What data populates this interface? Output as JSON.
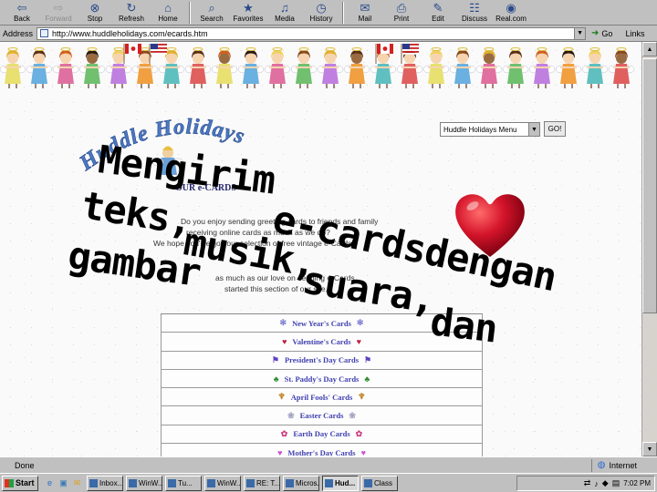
{
  "toolbar": {
    "buttons": [
      {
        "name": "back",
        "label": "Back",
        "icon": "arrow-left-icon",
        "glyph": "⇦",
        "enabled": true
      },
      {
        "name": "forward",
        "label": "Forward",
        "icon": "arrow-right-icon",
        "glyph": "⇨",
        "enabled": false
      },
      {
        "name": "stop",
        "label": "Stop",
        "icon": "stop-icon",
        "glyph": "⊗",
        "enabled": true
      },
      {
        "name": "refresh",
        "label": "Refresh",
        "icon": "refresh-icon",
        "glyph": "↻",
        "enabled": true
      },
      {
        "name": "home",
        "label": "Home",
        "icon": "home-icon",
        "glyph": "⌂",
        "enabled": true
      },
      {
        "name": "search",
        "label": "Search",
        "icon": "search-icon",
        "glyph": "⌕",
        "enabled": true
      },
      {
        "name": "favorites",
        "label": "Favorites",
        "icon": "star-icon",
        "glyph": "★",
        "enabled": true
      },
      {
        "name": "media",
        "label": "Media",
        "icon": "media-icon",
        "glyph": "♫",
        "enabled": true
      },
      {
        "name": "history",
        "label": "History",
        "icon": "history-icon",
        "glyph": "◷",
        "enabled": true
      },
      {
        "name": "mail",
        "label": "Mail",
        "icon": "mail-icon",
        "glyph": "✉",
        "enabled": true
      },
      {
        "name": "print",
        "label": "Print",
        "icon": "print-icon",
        "glyph": "⎙",
        "enabled": true
      },
      {
        "name": "edit",
        "label": "Edit",
        "icon": "edit-icon",
        "glyph": "✎",
        "enabled": true
      },
      {
        "name": "discuss",
        "label": "Discuss",
        "icon": "discuss-icon",
        "glyph": "☷",
        "enabled": true
      },
      {
        "name": "real",
        "label": "Real.com",
        "icon": "real-icon",
        "glyph": "◉",
        "enabled": true
      }
    ]
  },
  "address": {
    "label": "Address",
    "url": "http://www.huddleholidays.com/ecards.htm",
    "go_label": "Go",
    "links_label": "Links"
  },
  "page": {
    "logo_text": "Huddle Holidays",
    "section_title": "OUR e-CARDS",
    "menu_select": "Huddle Holidays Menu",
    "menu_go": "GO!",
    "intro_lines": [
      "Do you enjoy sending greeting cards to friends and family",
      "receiving online cards as much as we do?",
      "We hope you'll enjoy our selection of free vintage e-Cards",
      "as much as our love on sending e-Cards",
      "started this section of our site."
    ],
    "cards": [
      {
        "label": "New Year's Cards",
        "icon_name": "snowflake-icon",
        "glyph": "✻",
        "color": "#7a7ad0"
      },
      {
        "label": "Valentine's Cards",
        "icon_name": "heart-icon",
        "glyph": "♥",
        "color": "#c02040"
      },
      {
        "label": "President's Day Cards",
        "icon_name": "flag-icon",
        "glyph": "⚑",
        "color": "#6040c0"
      },
      {
        "label": "St. Paddy's Day Cards",
        "icon_name": "shamrock-icon",
        "glyph": "♣",
        "color": "#2a8a2a"
      },
      {
        "label": "April Fools' Cards",
        "icon_name": "jester-icon",
        "glyph": "♆",
        "color": "#c08020"
      },
      {
        "label": "Easter Cards",
        "icon_name": "bunny-icon",
        "glyph": "❀",
        "color": "#a0a0c0"
      },
      {
        "label": "Earth Day Cards",
        "icon_name": "earth-icon",
        "glyph": "✿",
        "color": "#d04080"
      },
      {
        "label": "Mother's Day Cards",
        "icon_name": "heart-icon",
        "glyph": "♥",
        "color": "#d050d0"
      }
    ]
  },
  "overlay": {
    "w1": "Mengirim",
    "w2": "e-cardsdengan",
    "w3": "teks,",
    "w4": "musik,",
    "w5": "suara,",
    "w6": "dan",
    "w7": "gambar"
  },
  "status": {
    "text": "Done",
    "zone": "Internet"
  },
  "taskbar": {
    "start_label": "Start",
    "tasks": [
      {
        "label": "Inbox...",
        "active": false
      },
      {
        "label": "WinW...",
        "active": false
      },
      {
        "label": "Tu...",
        "active": false
      },
      {
        "label": "WinW...",
        "active": false
      },
      {
        "label": "RE: T...",
        "active": false
      },
      {
        "label": "Micros...",
        "active": false
      },
      {
        "label": "Hud...",
        "active": true
      },
      {
        "label": "Class",
        "active": false
      }
    ],
    "clock": "7:02 PM"
  },
  "colors": {
    "link": "#4040b0",
    "heart": "#d4142a",
    "logo": "#4a78c0"
  }
}
